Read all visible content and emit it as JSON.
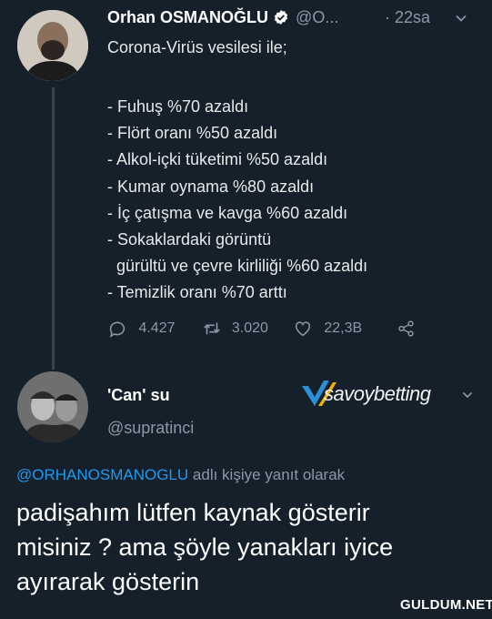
{
  "tweet": {
    "author_name": "Orhan OSMANOĞLU",
    "author_handle": "@O...",
    "time": "· 22sa",
    "intro": "Corona-Virüs vesilesi ile;",
    "lines": [
      "- Fuhuş %70 azaldı",
      "- Flört oranı %50 azaldı",
      "- Alkol-içki tüketimi %50 azaldı",
      "- Kumar oynama %80 azaldı",
      "- İç çatışma ve kavga %60 azaldı",
      "- Sokaklardaki görüntü",
      "gürültü ve çevre kirliliği %60 azaldı",
      "- Temizlik oranı %70 arttı"
    ],
    "stats": {
      "replies": "4.427",
      "retweets": "3.020",
      "likes": "22,3B"
    }
  },
  "reply": {
    "author_name": "'Can' su",
    "author_handle": "@supratinci",
    "sponsor_text": "savoybetting",
    "reply_to_handle": "@ORHANOSMANOGLU",
    "reply_to_suffix": "adlı kişiye yanıt olarak",
    "text_lines": [
      "padişahım lütfen kaynak gösterir",
      "misiniz ? ama şöyle yanakları iyice",
      "ayırarak gösterin"
    ]
  },
  "watermark": "GULDUM.NET",
  "colors": {
    "background": "#15202b",
    "link": "#1d9bf0",
    "muted": "#8b98a5",
    "verified": "#1d9bf0"
  }
}
